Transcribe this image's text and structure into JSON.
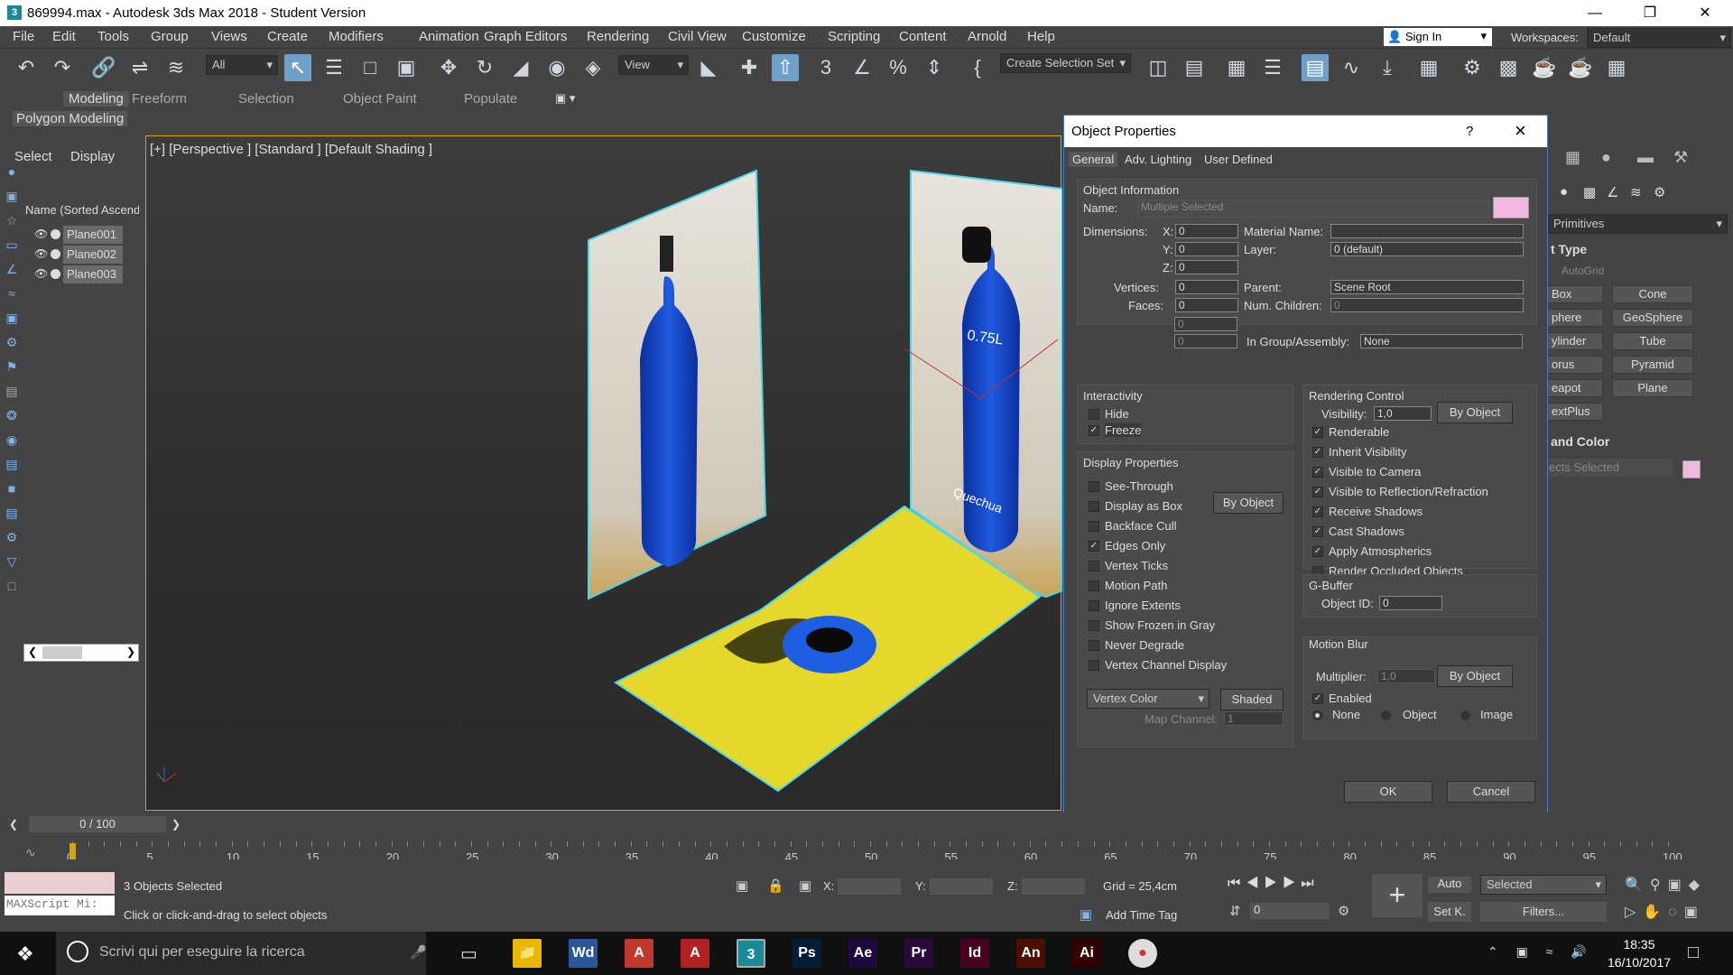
{
  "window": {
    "title": "869994.max - Autodesk 3ds Max 2018 - Student Version",
    "icon": "3ds-max-icon"
  },
  "menubar": {
    "items": [
      "File",
      "Edit",
      "Tools",
      "Group",
      "Views",
      "Create",
      "Modifiers",
      "Animation",
      "Graph Editors",
      "Rendering",
      "Civil View",
      "Customize",
      "Scripting",
      "Content",
      "Arnold",
      "Help"
    ],
    "signin": "Sign In",
    "workspaces_label": "Workspaces:",
    "workspace": "Default"
  },
  "toolbar": {
    "filter": "All",
    "view": "View",
    "selection_set": "Create Selection Set"
  },
  "ribbon": {
    "tabs": [
      "Modeling",
      "Freeform",
      "Selection",
      "Object Paint",
      "Populate"
    ],
    "sub": "Polygon Modeling"
  },
  "scene_explorer": {
    "tabs": [
      "Select",
      "Display"
    ],
    "header": "Name (Sorted Ascend",
    "items": [
      "Plane001",
      "Plane002",
      "Plane003"
    ]
  },
  "viewport": {
    "label": "[+] [Perspective ] [Standard ] [Default Shading ]",
    "bottle_text": "0.75L",
    "brand": "Quechua"
  },
  "command_panel": {
    "category": "Primitives",
    "object_type": "t Type",
    "autogrid": "AutoGrid",
    "buttons": [
      "Box",
      "Cone",
      "phere",
      "GeoSphere",
      "ylinder",
      "Tube",
      "orus",
      "Pyramid",
      "eapot",
      "Plane",
      "extPlus"
    ],
    "name_color": "and Color",
    "name_value": "ects Selected",
    "swatch": "#f0b8e0"
  },
  "dialog": {
    "title": "Object Properties",
    "help": "?",
    "close": "×",
    "tabs": [
      "General",
      "Adv. Lighting",
      "User Defined"
    ],
    "object_info": {
      "header": "Object Information",
      "name_label": "Name:",
      "name_value": "Multiple Selected",
      "swatch": "#f0b8e0",
      "dimensions_label": "Dimensions:",
      "x_label": "X:",
      "y_label": "Y:",
      "z_label": "Z:",
      "x": "0",
      "y": "0",
      "z": "0",
      "vertices_label": "Vertices:",
      "vertices": "0",
      "faces_label": "Faces:",
      "faces": "0",
      "extra1": "0",
      "extra2": "0",
      "material_label": "Material Name:",
      "material": "",
      "layer_label": "Layer:",
      "layer": "0 (default)",
      "parent_label": "Parent:",
      "parent": "Scene Root",
      "children_label": "Num. Children:",
      "children": "0",
      "group_label": "In Group/Assembly:",
      "group": "None"
    },
    "interactivity": {
      "header": "Interactivity",
      "hide": "Hide",
      "freeze": "Freeze"
    },
    "display": {
      "header": "Display Properties",
      "by_object": "By Object",
      "items": [
        "See-Through",
        "Display as Box",
        "Backface Cull",
        "Edges Only",
        "Vertex Ticks",
        "Motion Path",
        "Ignore Extents",
        "Show Frozen in Gray",
        "Never Degrade",
        "Vertex Channel Display"
      ],
      "vertex_color": "Vertex Color",
      "shaded": "Shaded",
      "map_channel_label": "Map Channel:",
      "map_channel": "1"
    },
    "rendering": {
      "header": "Rendering Control",
      "visibility_label": "Visibility:",
      "visibility": "1,0",
      "by_object": "By Object",
      "items": [
        "Renderable",
        "Inherit Visibility",
        "Visible to Camera",
        "Visible to Reflection/Refraction",
        "Receive Shadows",
        "Cast Shadows",
        "Apply Atmospherics",
        "Render Occluded Objects"
      ]
    },
    "gbuffer": {
      "header": "G-Buffer",
      "label": "Object ID:",
      "value": "0"
    },
    "motion_blur": {
      "header": "Motion Blur",
      "multiplier_label": "Multiplier:",
      "multiplier": "1,0",
      "by_object": "By Object",
      "enabled": "Enabled",
      "none": "None",
      "object": "Object",
      "image": "Image"
    },
    "ok": "OK",
    "cancel": "Cancel"
  },
  "timeline": {
    "frame": "0 / 100",
    "ticks": [
      "0",
      "5",
      "10",
      "15",
      "20",
      "25",
      "30",
      "35",
      "40",
      "45",
      "50",
      "55",
      "60",
      "65",
      "70",
      "75",
      "80",
      "85",
      "90",
      "95",
      "100"
    ]
  },
  "status": {
    "maxscript": "MAXScript Mi:",
    "selected": "3 Objects Selected",
    "hint": "Click or click-and-drag to select objects",
    "x_label": "X:",
    "y_label": "Y:",
    "z_label": "Z:",
    "grid": "Grid = 25,4cm",
    "add_time_tag": "Add Time Tag",
    "auto": "Auto",
    "selected_dd": "Selected",
    "setk": "Set K.",
    "filters": "Filters...",
    "frame_field": "0"
  },
  "taskbar": {
    "search": "Scrivi qui per eseguire la ricerca",
    "time": "18:35",
    "date": "16/10/2017",
    "apps": [
      {
        "label": "Wd",
        "color": "#2b579a",
        "name": "word-icon"
      },
      {
        "label": "A",
        "color": "#c0392b",
        "name": "acrobat-icon"
      },
      {
        "label": "A",
        "color": "#b22222",
        "name": "autocad-icon"
      },
      {
        "label": "3",
        "color": "#1a8a9a",
        "name": "3ds-max-icon"
      },
      {
        "label": "Ps",
        "color": "#001e36",
        "name": "photoshop-icon"
      },
      {
        "label": "Ae",
        "color": "#1f0740",
        "name": "after-effects-icon"
      },
      {
        "label": "Pr",
        "color": "#2a0a3a",
        "name": "premiere-icon"
      },
      {
        "label": "Id",
        "color": "#49021f",
        "name": "indesign-icon"
      },
      {
        "label": "An",
        "color": "#4a0f00",
        "name": "animate-icon"
      },
      {
        "label": "Ai",
        "color": "#330000",
        "name": "illustrator-icon"
      }
    ]
  }
}
